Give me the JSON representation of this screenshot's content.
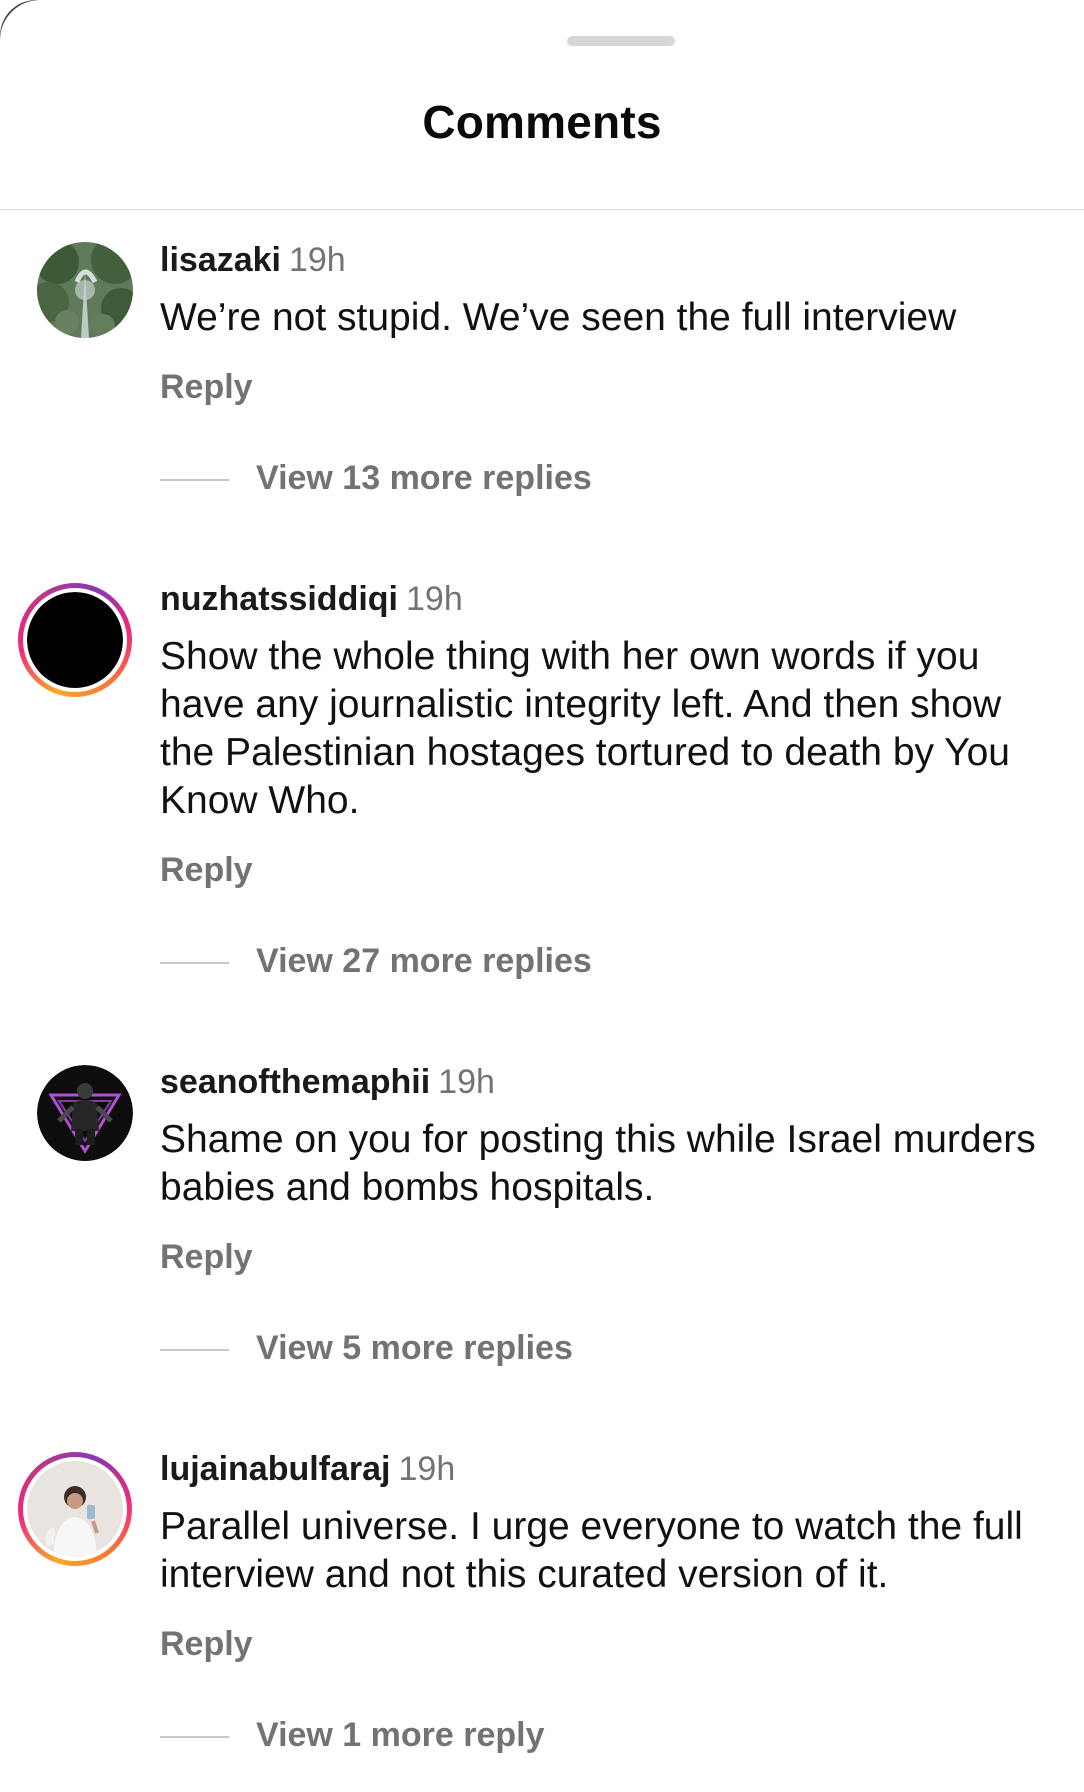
{
  "sheet": {
    "title": "Comments"
  },
  "comments": [
    {
      "username": "lisazaki",
      "time": "19h",
      "text": "We’re not stupid. We’ve seen the full interview",
      "reply_label": "Reply",
      "view_replies": "View 13 more replies",
      "avatar": "forest-canopy-avatar",
      "story_ring": false
    },
    {
      "username": "nuzhatssiddiqi",
      "time": "19h",
      "text": "Show the whole thing with her own words if you have any journalistic integrity left. And then show the Palestinian hostages tortured to death by You Know Who.",
      "reply_label": "Reply",
      "view_replies": "View 27 more replies",
      "avatar": "black-circle-avatar",
      "story_ring": true
    },
    {
      "username": "seanofthemaphii",
      "time": "19h",
      "text": "Shame on you for posting this while Israel murders babies and bombs hospitals.",
      "reply_label": "Reply",
      "view_replies": "View 5 more replies",
      "avatar": "person-triangle-avatar",
      "story_ring": false
    },
    {
      "username": "lujainabulfaraj",
      "time": "19h",
      "text": "Parallel universe. I urge everyone to watch the full interview and not this curated version of it.",
      "reply_label": "Reply",
      "view_replies": "View 1 more reply",
      "avatar": "person-selfie-avatar",
      "story_ring": true
    }
  ],
  "colors": {
    "secondary_text": "#737373",
    "divider": "#dbdbdb",
    "story_ring_start": "#f9a825",
    "story_ring_end": "#c13584"
  }
}
